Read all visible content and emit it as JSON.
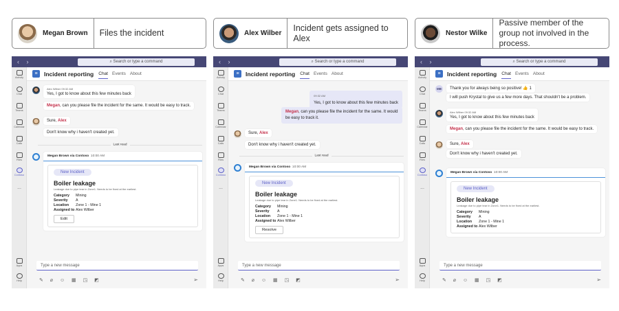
{
  "panels": [
    {
      "name": "Megan Brown",
      "description": "Files the incident",
      "search_placeholder": "Search or type a command",
      "channel": {
        "title": "Incident reporting",
        "tabs": [
          "Chat",
          "Events",
          "About"
        ]
      },
      "rail": [
        "Activity",
        "Chat",
        "Teams",
        "Calendar",
        "Calls",
        "Files",
        "Contoso",
        "...",
        "Apps",
        "Help"
      ],
      "messages": [
        {
          "meta": "Alex Wilber 09:32 AM",
          "text": "Yes, I got to know about this few minutes back"
        },
        {
          "mention": "Megan",
          "text": ", can you please file the incident for the same. It would be easy to track."
        },
        {
          "mention_prefix": "Sure, ",
          "mention": "Alex"
        },
        {
          "text": "Don't know why i haven't created yet."
        }
      ],
      "last_read": "Last read",
      "card": {
        "header_sender": "Megan Brown via Contoso",
        "header_time": "10:00 AM",
        "pill": "New Incident",
        "title": "Boiler leakage",
        "description": "Leakage due to pipe tear in Zone1. Needs to be fixed at the earliest.",
        "fields": [
          {
            "k": "Category",
            "v": "Mining"
          },
          {
            "k": "Severity",
            "v": "A"
          },
          {
            "k": "Location",
            "v": "Zone 1 - Mine 1"
          },
          {
            "k": "Assigned to",
            "v": "Alex Wilber"
          }
        ],
        "action": "Edit"
      },
      "compose_placeholder": "Type a new message"
    },
    {
      "name": "Alex Wilber",
      "description": "Incident gets assigned to Alex",
      "search_placeholder": "Search or type a command",
      "channel": {
        "title": "Incident reporting",
        "tabs": [
          "Chat",
          "Events",
          "About"
        ]
      },
      "rail": [
        "Activity",
        "Chat",
        "Teams",
        "Calendar",
        "Calls",
        "Files",
        "Contoso",
        "...",
        "Apps",
        "Help"
      ],
      "messages": [
        {
          "meta": "09:32 AM",
          "text": "Yes, I got to know about this few minutes back"
        },
        {
          "mention": "Megan",
          "text": ", can you please file the incident for the same. It would be easy to track it."
        },
        {
          "mention_prefix": "Sure, ",
          "mention": "Alex"
        },
        {
          "text": "Don't know why i haven't created yet."
        }
      ],
      "last_read": "Last read",
      "card": {
        "header_sender": "Megan Brown via Contoso",
        "header_time": "10:00 AM",
        "pill": "New Incident",
        "title": "Boiler leakage",
        "description": "Leakage due to pipe tear in Zone1. Needs to be fixed at the earliest.",
        "fields": [
          {
            "k": "Category",
            "v": "Mining"
          },
          {
            "k": "Severity",
            "v": "A"
          },
          {
            "k": "Location",
            "v": "Zone 1 - Mine 1"
          },
          {
            "k": "Assigned to",
            "v": "Alex Wilber"
          }
        ],
        "action": "Resolve"
      },
      "compose_placeholder": "Type a new message"
    },
    {
      "name": "Nestor Wilke",
      "description": "Passive member of the group not involved in the process.",
      "search_placeholder": "Search or type a command",
      "channel": {
        "title": "Incident reporting",
        "tabs": [
          "Chat",
          "Events",
          "About"
        ]
      },
      "rail": [
        "Activity",
        "Chat",
        "Teams",
        "Calendar",
        "Calls",
        "Files",
        "Contoso",
        "...",
        "Apps",
        "Help"
      ],
      "messages": [
        {
          "avatar": "MB",
          "text": "Thank you for always being so positive! 👍 1"
        },
        {
          "text": "I will push Krystal to give us a few more days. That shouldn't be a problem."
        },
        {
          "meta": "Alex Wilber 09:32 AM",
          "text": "Yes, I got to know about this few minutes back"
        },
        {
          "mention": "Megan",
          "text": ", can you please file the incident for the same. It would be easy to track."
        },
        {
          "mention_prefix": "Sure, ",
          "mention": "Alex"
        },
        {
          "text": "Don't know why i haven't created yet."
        }
      ],
      "card": {
        "header_sender": "Megan Brown via Contoso",
        "header_time": "10:00 AM",
        "pill": "New Incident",
        "title": "Boiler leakage",
        "description": "Leakage due to pipe tear in Zone1. Needs to be fixed at the earliest.",
        "fields": [
          {
            "k": "Category",
            "v": "Mining"
          },
          {
            "k": "Severity",
            "v": "A"
          },
          {
            "k": "Location",
            "v": "Zone 1 - Mine 1"
          },
          {
            "k": "Assigned to",
            "v": "Alex Wilber"
          }
        ],
        "action": ""
      },
      "compose_placeholder": "Type a new message"
    }
  ],
  "colors": {
    "accent": "#5b5fc7",
    "topbar": "#464775",
    "mention": "#c4314b"
  }
}
